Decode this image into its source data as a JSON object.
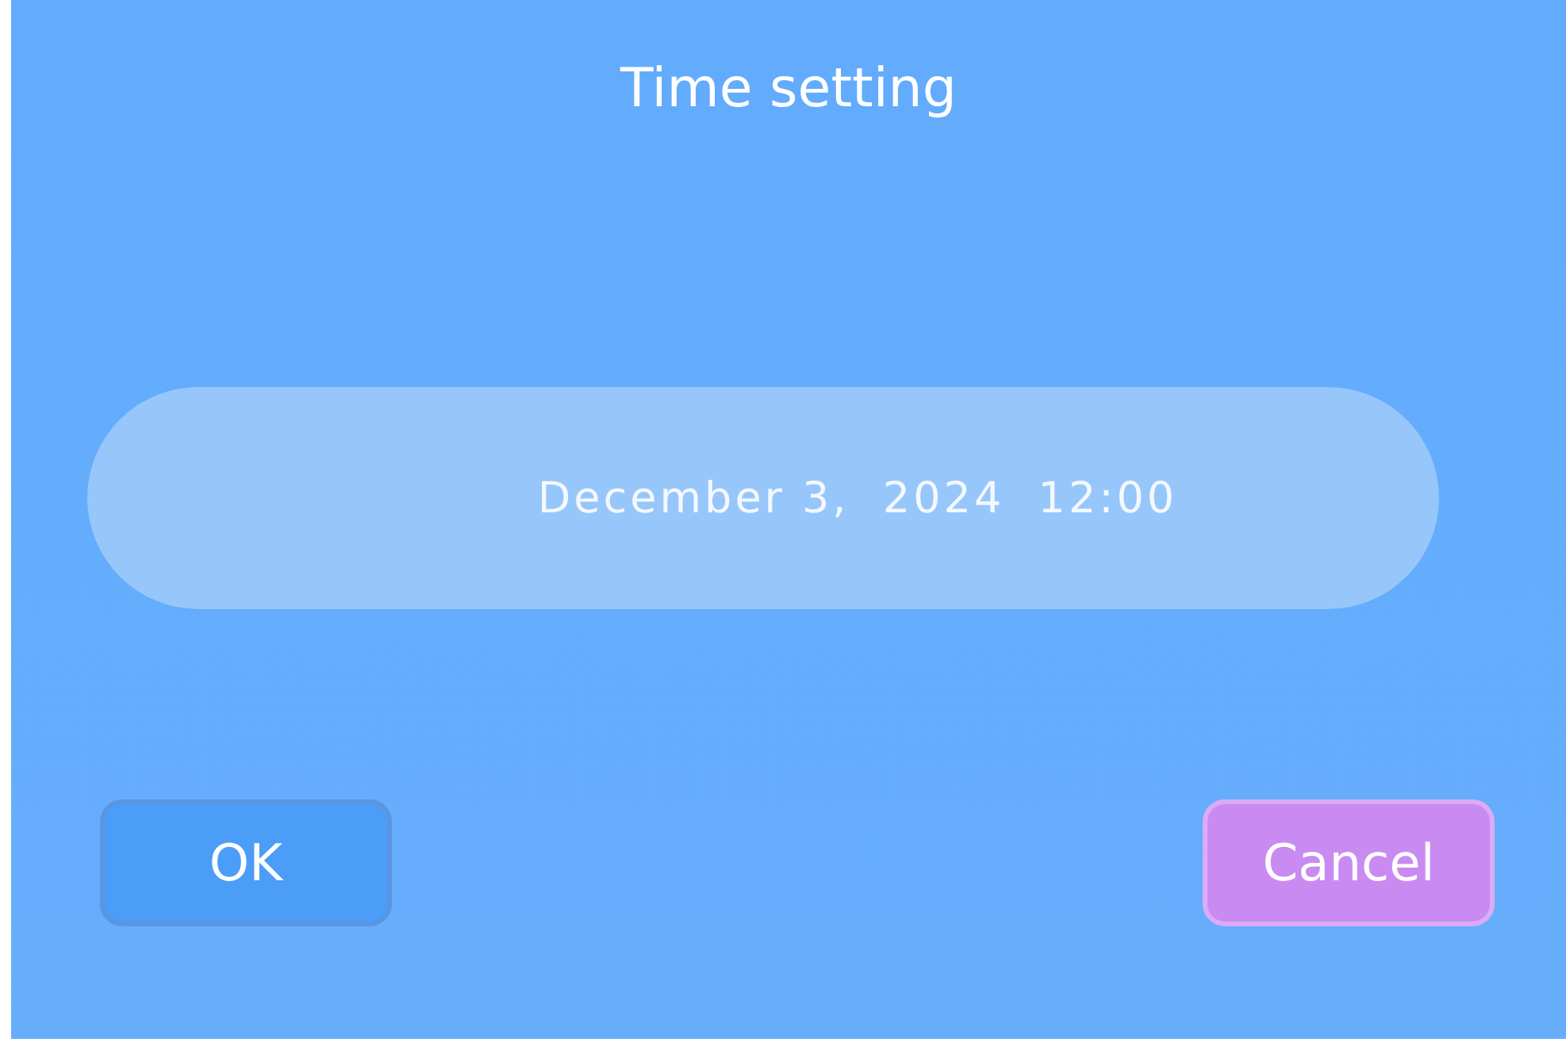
{
  "title": "Time setting",
  "datetime": "December 3,  2024  12:00",
  "buttons": [
    {
      "label": "OK",
      "kind": "primary"
    },
    {
      "label": "Cancel",
      "kind": "cancel"
    }
  ]
}
